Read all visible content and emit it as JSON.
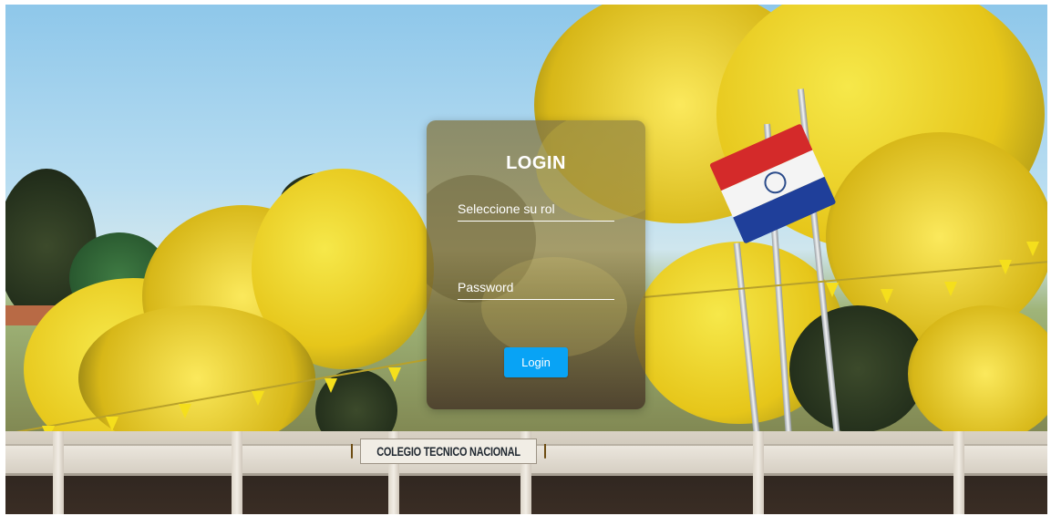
{
  "login": {
    "title": "LOGIN",
    "role_placeholder": "Seleccione su rol",
    "password_placeholder": "Password",
    "button_label": "Login"
  },
  "background": {
    "school_sign_text": "COLEGIO TECNICO NACIONAL"
  },
  "colors": {
    "button": "#08a3f5",
    "text": "#ffffff"
  }
}
